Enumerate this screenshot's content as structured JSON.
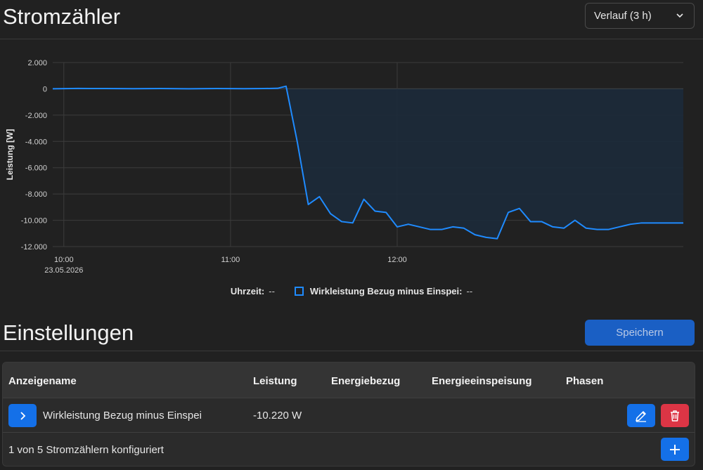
{
  "header": {
    "title": "Stromzähler",
    "view_select": "Verlauf (3 h)"
  },
  "chart_data": {
    "type": "area",
    "ylabel": "Leistung [W]",
    "y_ticks": [
      "2.000",
      "0",
      "-2.000",
      "-4.000",
      "-6.000",
      "-8.000",
      "-10.000",
      "-12.000"
    ],
    "ylim": [
      -12000,
      2000
    ],
    "x_ticks": [
      {
        "label": "10:00",
        "sub": "23.05.2026",
        "t": 0
      },
      {
        "label": "11:00",
        "sub": "",
        "t": 60
      },
      {
        "label": "12:00",
        "sub": "",
        "t": 120
      }
    ],
    "series": [
      {
        "name": "Wirkleistung Bezug minus Einspei",
        "color": "#1f8bff",
        "points": [
          [
            -4,
            0
          ],
          [
            5,
            30
          ],
          [
            15,
            20
          ],
          [
            25,
            10
          ],
          [
            35,
            20
          ],
          [
            45,
            0
          ],
          [
            55,
            20
          ],
          [
            65,
            10
          ],
          [
            72,
            20
          ],
          [
            77,
            40
          ],
          [
            80,
            200
          ],
          [
            84,
            -4000
          ],
          [
            88,
            -8800
          ],
          [
            92,
            -8200
          ],
          [
            96,
            -9500
          ],
          [
            100,
            -10100
          ],
          [
            104,
            -10200
          ],
          [
            108,
            -8400
          ],
          [
            112,
            -9300
          ],
          [
            116,
            -9400
          ],
          [
            120,
            -10500
          ],
          [
            124,
            -10300
          ],
          [
            128,
            -10500
          ],
          [
            132,
            -10700
          ],
          [
            136,
            -10700
          ],
          [
            140,
            -10500
          ],
          [
            144,
            -10600
          ],
          [
            148,
            -11100
          ],
          [
            152,
            -11300
          ],
          [
            156,
            -11400
          ],
          [
            160,
            -9400
          ],
          [
            164,
            -9100
          ],
          [
            168,
            -10100
          ],
          [
            172,
            -10100
          ],
          [
            176,
            -10500
          ],
          [
            180,
            -10600
          ],
          [
            184,
            -10000
          ],
          [
            188,
            -10600
          ],
          [
            192,
            -10700
          ],
          [
            196,
            -10700
          ],
          [
            200,
            -10500
          ],
          [
            204,
            -10300
          ],
          [
            208,
            -10200
          ],
          [
            212,
            -10200
          ],
          [
            216,
            -10200
          ],
          [
            223,
            -10200
          ]
        ]
      }
    ]
  },
  "legend": {
    "x_label": "Uhrzeit:",
    "x_value": "--",
    "series_label": "Wirkleistung Bezug minus Einspei:",
    "series_value": "--"
  },
  "settings": {
    "title": "Einstellungen",
    "save_label": "Speichern",
    "columns": [
      "Anzeigename",
      "Leistung",
      "Energiebezug",
      "Energieeinspeisung",
      "Phasen"
    ],
    "rows": [
      {
        "name": "Wirkleistung Bezug minus Einspei",
        "power": "-10.220 W",
        "import": "",
        "export": "",
        "phases": ""
      }
    ],
    "footer": "1 von 5 Stromzählern konfiguriert"
  },
  "icons": {
    "expand": "chevron-right-icon",
    "edit": "pencil-icon",
    "delete": "trash-icon",
    "add": "plus-icon",
    "select": "chevron-down-icon"
  },
  "colors": {
    "accent": "#1470e8",
    "danger": "#dc3545",
    "line": "#1f8bff",
    "area": "#1c2a3a"
  }
}
